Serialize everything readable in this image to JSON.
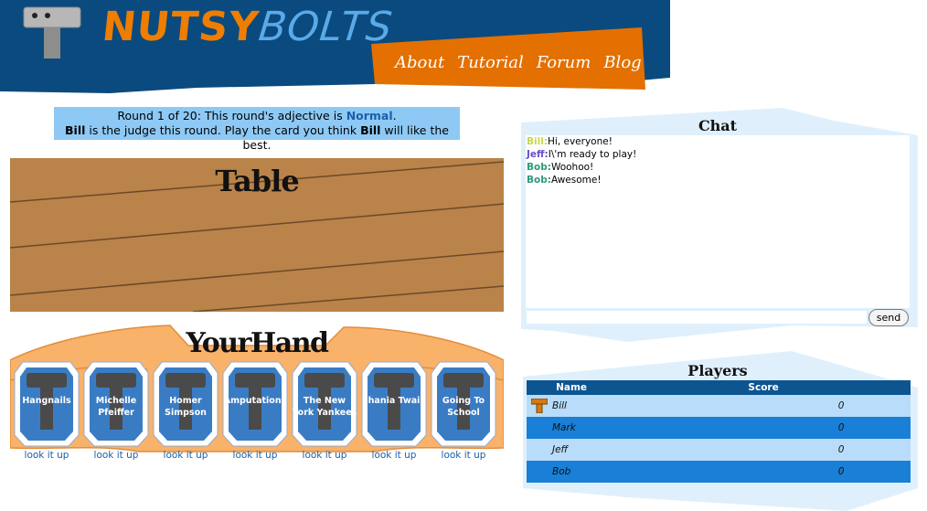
{
  "header": {
    "logo_part1": "NUTSY",
    "logo_part2": "BOLTS",
    "logo_icon": "hammer-icon",
    "nav": [
      "About",
      "Tutorial",
      "Forum",
      "Blog"
    ]
  },
  "round": {
    "prefix": "Round 1 of 20: This round's adjective is ",
    "adjective": "Normal",
    "period": ".",
    "judge": "Bill",
    "line2_mid": " is the judge this round. Play the card you think ",
    "judge2": "Bill",
    "line2_end": " will like the best."
  },
  "table": {
    "title": "Table"
  },
  "hand": {
    "title": "YourHand",
    "lookup_label": "look it up",
    "cards": [
      "Hangnails",
      "Michelle Pfeiffer",
      "Homer Simpson",
      "Amputations",
      "The New York Yankees",
      "Shania Twain",
      "Going To School"
    ]
  },
  "chat": {
    "title": "Chat",
    "messages": [
      {
        "name": "Bill:",
        "text": "Hi, everyone!",
        "color": "#c8d84a"
      },
      {
        "name": "Jeff:",
        "text": "I\\'m ready to play!",
        "color": "#6a4fc8"
      },
      {
        "name": "Bob:",
        "text": "Woohoo!",
        "color": "#2e9a7a"
      },
      {
        "name": "Bob:",
        "text": "Awesome!",
        "color": "#2e9a7a"
      }
    ],
    "input_value": "",
    "send_label": "send"
  },
  "players": {
    "title": "Players",
    "col_name": "Name",
    "col_score": "Score",
    "rows": [
      {
        "name": "Bill",
        "score": "0",
        "judge": true
      },
      {
        "name": "Mark",
        "score": "0",
        "judge": false
      },
      {
        "name": "Jeff",
        "score": "0",
        "judge": false
      },
      {
        "name": "Bob",
        "score": "0",
        "judge": false
      }
    ]
  },
  "colors": {
    "header_blue": "#0b4a7e",
    "nav_orange": "#e37000",
    "table_wood": "#b98349",
    "card_blue": "#3a7cc4",
    "panel_light": "#dff0fc"
  }
}
